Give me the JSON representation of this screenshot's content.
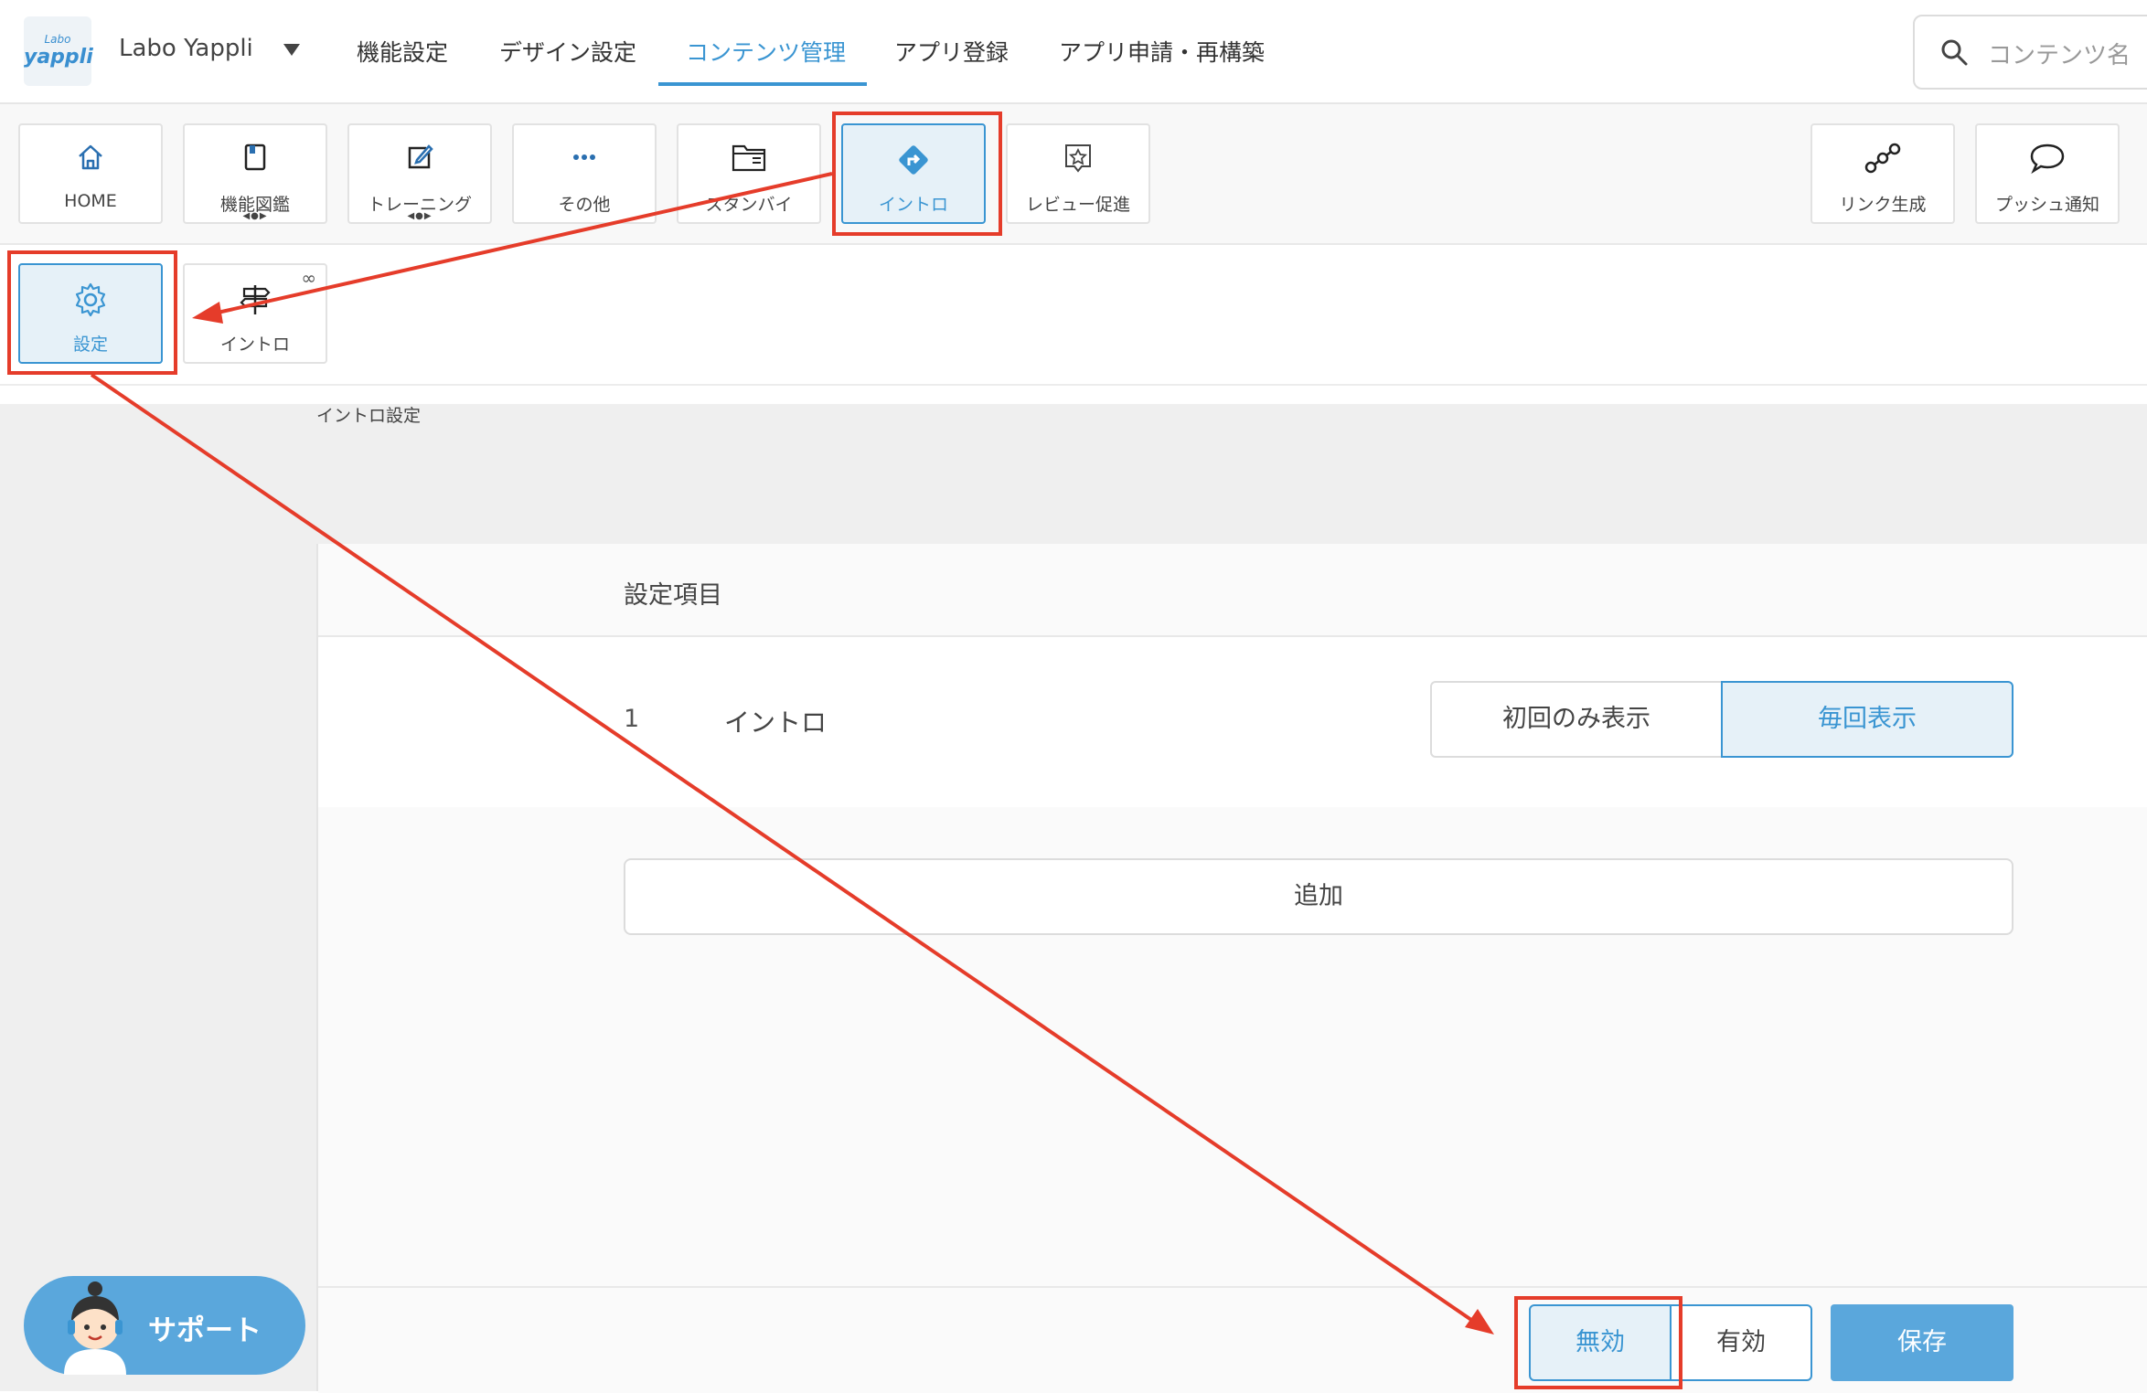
{
  "header": {
    "logo_small": "Labo",
    "logo_big": "yappli",
    "app_name": "Labo Yappli",
    "nav": [
      {
        "label": "機能設定"
      },
      {
        "label": "デザイン設定"
      },
      {
        "label": "コンテンツ管理"
      },
      {
        "label": "アプリ登録"
      },
      {
        "label": "アプリ申請・再構築"
      }
    ],
    "active_nav": "コンテンツ管理",
    "search_placeholder": "コンテンツ名"
  },
  "toolbar": {
    "left": [
      {
        "label": "HOME",
        "icon": "home-icon"
      },
      {
        "label": "機能図鑑",
        "icon": "book-icon",
        "arrows": "◀●▶"
      },
      {
        "label": "トレーニング",
        "icon": "edit-icon",
        "arrows": "◀●▶"
      },
      {
        "label": "その他",
        "icon": "more-dots-icon"
      },
      {
        "label": "スタンバイ",
        "icon": "folder-icon"
      },
      {
        "label": "イントロ",
        "icon": "intro-arrow-icon",
        "selected": true
      },
      {
        "label": "レビュー促進",
        "icon": "star-icon"
      }
    ],
    "right": [
      {
        "label": "リンク生成",
        "icon": "link-nodes-icon"
      },
      {
        "label": "プッシュ通知",
        "icon": "speech-bubble-icon"
      }
    ]
  },
  "subtoolbar": [
    {
      "label": "設定",
      "icon": "gear-icon",
      "selected": true
    },
    {
      "label": "イントロ",
      "icon": "signpost-icon",
      "badge": "∞"
    }
  ],
  "breadcrumb": "イントロ設定",
  "panel": {
    "title": "設定項目",
    "rows": [
      {
        "num": "1",
        "name": "イントロ"
      }
    ],
    "display_options": [
      "初回のみ表示",
      "毎回表示"
    ],
    "display_selected": "毎回表示",
    "add_label": "追加",
    "footer": {
      "disable_label": "無効",
      "enable_label": "有効",
      "status_selected": "無効",
      "save_label": "保存"
    }
  },
  "support": {
    "label": "サポート"
  },
  "colors": {
    "accent": "#3a95d2",
    "annotation": "#e53c2a",
    "save": "#5aa7dc"
  }
}
